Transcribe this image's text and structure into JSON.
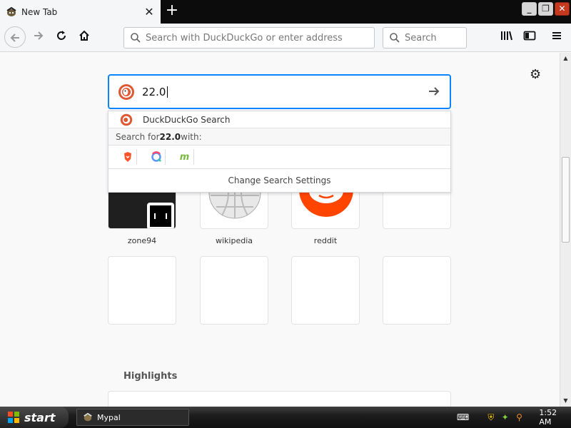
{
  "tab": {
    "title": "New Tab",
    "close": "✕",
    "new_tab": "+"
  },
  "window": {
    "minimize": "_",
    "maximize": "❐",
    "close": "✕"
  },
  "navbar": {
    "url_placeholder": "Search with DuckDuckGo or enter address",
    "search_placeholder": "Search"
  },
  "newtab": {
    "search_value": "22.0",
    "dropdown": {
      "engine_label": "DuckDuckGo Search",
      "search_for_prefix": "Search for ",
      "search_for_term": "22.0",
      "search_for_suffix": " with:",
      "settings_label": "Change Search Settings"
    },
    "top_sites": [
      {
        "label": "zone94"
      },
      {
        "label": "wikipedia"
      },
      {
        "label": "reddit"
      },
      {
        "label": ""
      }
    ],
    "highlights_title": "Highlights"
  },
  "taskbar": {
    "start_label": "start",
    "task_label": "Mypal",
    "clock": "1:52 AM"
  },
  "colors": {
    "focus": "#0a84ff",
    "reddit": "#ff4500",
    "ddg": "#de5833"
  }
}
